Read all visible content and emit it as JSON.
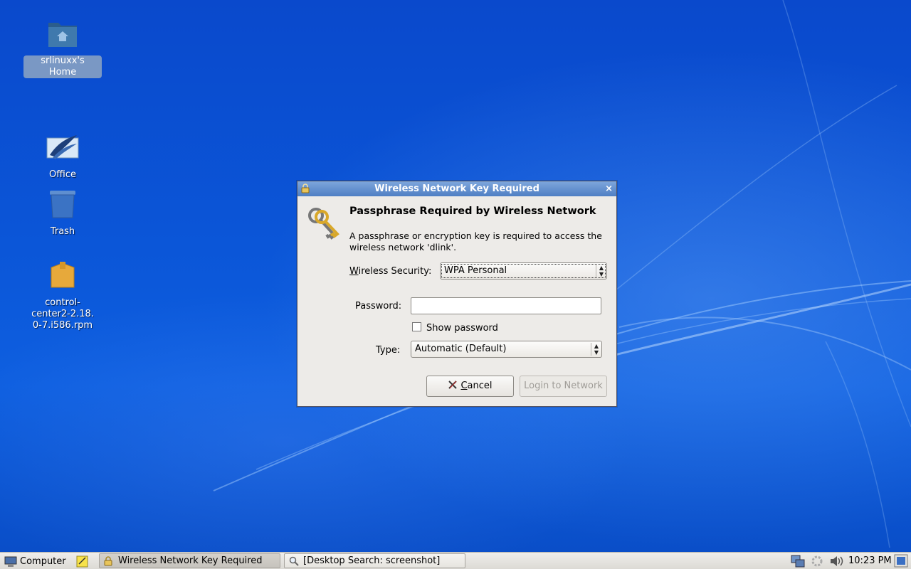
{
  "desktop": {
    "icons": [
      {
        "label": "srlinuxx's Home",
        "icon": "home-folder-icon"
      },
      {
        "label": "Office",
        "icon": "openoffice-icon"
      },
      {
        "label": "Trash",
        "icon": "trash-icon"
      },
      {
        "label_line1": "control-center2-2.18.",
        "label_line2": "0-7.i586.rpm",
        "icon": "package-icon"
      }
    ]
  },
  "dialog": {
    "title": "Wireless Network Key Required",
    "close_glyph": "×",
    "heading": "Passphrase Required by Wireless Network",
    "message": "A passphrase or encryption key is required to access the wireless network 'dlink'.",
    "security": {
      "label_accel": "W",
      "label_rest": "ireless Security:",
      "value": "WPA Personal"
    },
    "password": {
      "label": "Password:",
      "value": "",
      "placeholder": ""
    },
    "show_password": {
      "label": "Show password",
      "checked": false
    },
    "type": {
      "label": "Type:",
      "value": "Automatic (Default)"
    },
    "buttons": {
      "cancel_accel": "C",
      "cancel_rest": "ancel",
      "login": "Login to Network"
    }
  },
  "taskbar": {
    "menu_label": "Computer",
    "tasks": [
      {
        "label": "Wireless Network Key Required",
        "active": true
      },
      {
        "label": "[Desktop Search: screenshot]",
        "active": false
      }
    ],
    "clock": "10:23 PM"
  },
  "colors": {
    "desktop_blue": "#0b4fd0",
    "titlebar_blue": "#4f7fc4",
    "dialog_bg": "#edebe8"
  }
}
